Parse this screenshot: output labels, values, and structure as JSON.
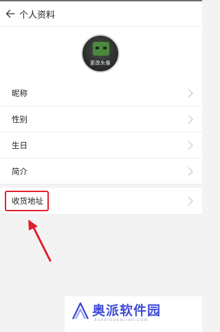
{
  "header": {
    "title": "个人资料",
    "back_icon": "arrow-left-icon"
  },
  "avatar": {
    "caption": "更改头像"
  },
  "profile_items": [
    {
      "label": "昵称"
    },
    {
      "label": "性别"
    },
    {
      "label": "生日"
    },
    {
      "label": "简介"
    }
  ],
  "address_item": {
    "label": "收货地址"
  },
  "annotation": {
    "box_color": "#e0202a",
    "arrow_color": "#e0202a"
  },
  "watermark": {
    "brand": "奥派软件园",
    "subtitle": "AOPAIRUANJIAN.COM",
    "logo_color": "#3f4bd8"
  },
  "colors": {
    "page_bg": "#f3f3f3",
    "row_bg": "#ffffff",
    "divider": "#ececec",
    "chevron": "#c4c4c4"
  }
}
